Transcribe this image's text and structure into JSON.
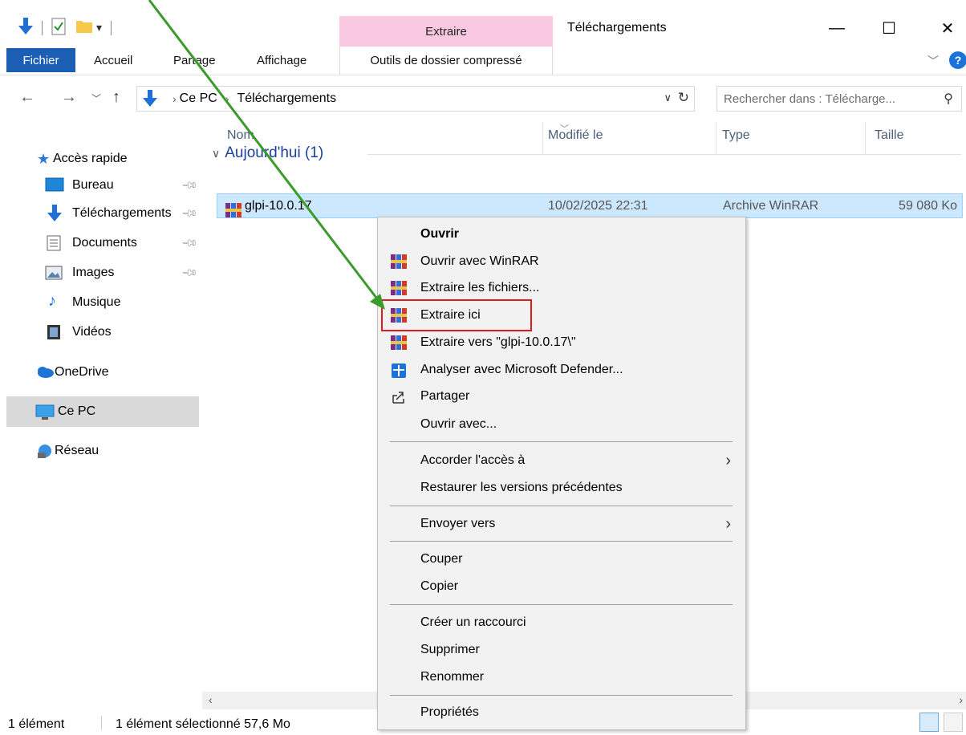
{
  "titlebar": {
    "window_title": "Téléchargements",
    "context_tab_header": "Extraire",
    "minimize": "—",
    "maximize": "☐",
    "close": "✕"
  },
  "ribbon": {
    "tabs": [
      "Fichier",
      "Accueil",
      "Partage",
      "Affichage",
      "Outils de dossier compressé"
    ],
    "help": "?"
  },
  "address": {
    "crumbs": [
      "Ce PC",
      "Téléchargements"
    ],
    "search_placeholder": "Rechercher dans : Télécharge..."
  },
  "navpane": {
    "quick_access": "Accès rapide",
    "items": [
      "Bureau",
      "Téléchargements",
      "Documents",
      "Images",
      "Musique",
      "Vidéos"
    ],
    "onedrive": "OneDrive",
    "this_pc": "Ce PC",
    "network": "Réseau"
  },
  "columns": {
    "name": "Nom",
    "modified": "Modifié le",
    "type": "Type",
    "size": "Taille"
  },
  "group": {
    "label": "Aujourd'hui (1)"
  },
  "file": {
    "name": "glpi-10.0.17",
    "modified": "10/02/2025 22:31",
    "type": "Archive WinRAR",
    "size": "59 080 Ko"
  },
  "context_menu": {
    "items": [
      "Ouvrir",
      "Ouvrir avec WinRAR",
      "Extraire les fichiers...",
      "Extraire ici",
      "Extraire vers \"glpi-10.0.17\\\"",
      "Analyser avec Microsoft Defender...",
      "Partager",
      "Ouvrir avec...",
      "Accorder l'accès à",
      "Restaurer les versions précédentes",
      "Envoyer vers",
      "Couper",
      "Copier",
      "Créer un raccourci",
      "Supprimer",
      "Renommer",
      "Propriétés"
    ]
  },
  "statusbar": {
    "count": "1 élément",
    "selection": "1 élément sélectionné 57,6 Mo"
  },
  "colors": {
    "accent": "#1a5fb4",
    "selection_bg": "#cce8ff",
    "context_tab": "#f9c8e1",
    "highlight_box": "#e01b1b",
    "annotation_arrow": "#3a9a2a"
  }
}
